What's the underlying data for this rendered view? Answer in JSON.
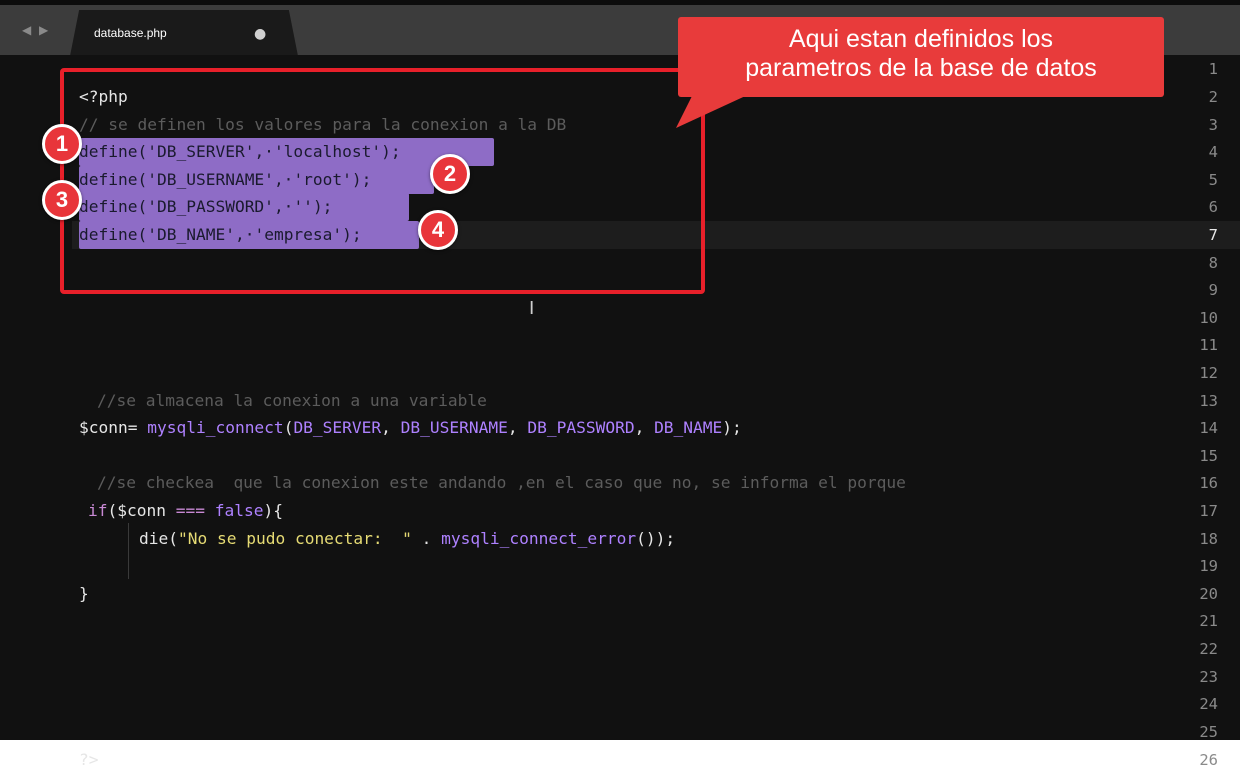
{
  "tab": {
    "filename": "database.php",
    "modified_indicator": "●"
  },
  "nav": {
    "arrows": "◀ ▶"
  },
  "callout": {
    "line1": "Aqui estan definidos los",
    "line2": "parametros de la base de datos"
  },
  "badges": [
    "1",
    "2",
    "3",
    "4"
  ],
  "line_numbers": [
    "1",
    "2",
    "3",
    "4",
    "5",
    "6",
    "7",
    "8",
    "9",
    "10",
    "11",
    "12",
    "13",
    "14",
    "15",
    "16",
    "17",
    "18",
    "19",
    "20",
    "21",
    "22",
    "23",
    "24",
    "25",
    "26"
  ],
  "code": {
    "l2": "<?php",
    "l3": "// se definen los valores para la conexion a la DB",
    "l4": {
      "fn": "define(",
      "arg1": "'DB_SERVER'",
      "sep": ",·",
      "arg2": "'localhost'",
      "end": ");"
    },
    "l5": {
      "fn": "define(",
      "arg1": "'DB_USERNAME'",
      "sep": ",·",
      "arg2": "'root'",
      "end": ");"
    },
    "l6": {
      "fn": "define(",
      "arg1": "'DB_PASSWORD'",
      "sep": ",·",
      "arg2": "''",
      "end": ");"
    },
    "l7": {
      "fn": "define(",
      "arg1": "'DB_NAME'",
      "sep": ",·",
      "arg2": "'empresa'",
      "end": ");"
    },
    "l14": "//se almacena la conexion a una variable",
    "l15": {
      "var": "$conn",
      "eq": "= ",
      "fn": "mysqli_connect",
      "open": "(",
      "c1": "DB_SERVER",
      "c2": "DB_USERNAME",
      "c3": "DB_PASSWORD",
      "c4": "DB_NAME",
      "sep": ", ",
      "close": ");"
    },
    "l17": "//se checkea  que la conexion este andando ,en el caso que no, se informa el porque",
    "l18": {
      "kw": "if",
      "open": "(",
      "var": "$conn",
      "op": " === ",
      "lit": "false",
      "close": "){"
    },
    "l19": {
      "fn": "die",
      "open": "(",
      "str": "\"No se pudo conectar:  \"",
      "dot": " . ",
      "fn2": "mysqli_connect_error",
      "close": "());"
    },
    "l21": "}",
    "l26": "?>"
  },
  "colors": {
    "highlight_box": "#e8202a",
    "callout": "#e83b3b",
    "selection": "#8e6cc6"
  }
}
